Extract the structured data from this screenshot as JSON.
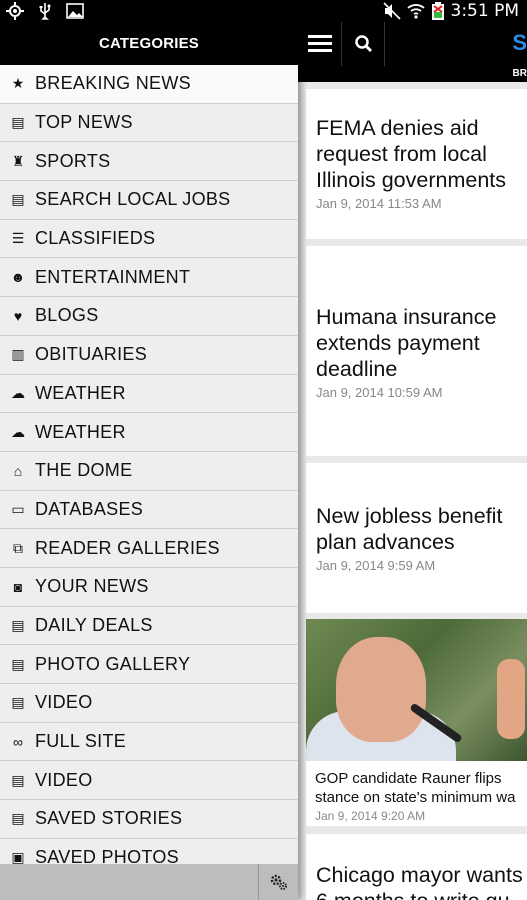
{
  "status_bar": {
    "time": "3:51 PM",
    "left_icons": [
      "gps-icon",
      "usb-icon",
      "image-icon"
    ],
    "right_icons": [
      "mute-icon",
      "wifi-icon",
      "battery-icon"
    ]
  },
  "drawer": {
    "title": "CATEGORIES",
    "items": [
      {
        "label": "BREAKING NEWS",
        "icon": "star-icon"
      },
      {
        "label": "TOP NEWS",
        "icon": "newspaper-icon"
      },
      {
        "label": "SPORTS",
        "icon": "trophy-icon"
      },
      {
        "label": "SEARCH LOCAL JOBS",
        "icon": "newspaper-icon"
      },
      {
        "label": "CLASSIFIEDS",
        "icon": "list-icon"
      },
      {
        "label": "ENTERTAINMENT",
        "icon": "masks-icon"
      },
      {
        "label": "BLOGS",
        "icon": "pin-icon"
      },
      {
        "label": "OBITUARIES",
        "icon": "tombstone-icon"
      },
      {
        "label": "WEATHER",
        "icon": "weather-icon"
      },
      {
        "label": "WEATHER",
        "icon": "weather-icon"
      },
      {
        "label": "THE DOME",
        "icon": "capitol-icon"
      },
      {
        "label": "DATABASES",
        "icon": "laptop-icon"
      },
      {
        "label": "READER GALLERIES",
        "icon": "gallery-icon"
      },
      {
        "label": "YOUR NEWS",
        "icon": "camera-icon"
      },
      {
        "label": "DAILY DEALS",
        "icon": "newspaper-icon"
      },
      {
        "label": "PHOTO GALLERY",
        "icon": "newspaper-icon"
      },
      {
        "label": "VIDEO",
        "icon": "newspaper-icon"
      },
      {
        "label": "FULL SITE",
        "icon": "link-icon"
      },
      {
        "label": "VIDEO",
        "icon": "newspaper-icon"
      },
      {
        "label": "SAVED STORIES",
        "icon": "saved-icon"
      },
      {
        "label": "SAVED PHOTOS",
        "icon": "saved-photo-icon"
      }
    ]
  },
  "news": {
    "logo": "S",
    "sub_label": "BR",
    "stories": [
      {
        "headline_lines": [
          "FEMA denies aid",
          "request from local",
          "Illinois governments"
        ],
        "date": "Jan 9, 2014 11:53 AM"
      },
      {
        "headline_lines": [
          "Humana insurance",
          "extends payment",
          "deadline"
        ],
        "date": "Jan 9, 2014 10:59 AM"
      },
      {
        "headline_lines": [
          "New jobless benefit",
          "plan advances"
        ],
        "date": "Jan 9, 2014 9:59 AM"
      },
      {
        "caption_lines": [
          "GOP candidate Rauner flips",
          "stance on state's minimum wa"
        ],
        "date": "Jan 9, 2014 9:20 AM"
      },
      {
        "headline_lines": [
          "Chicago mayor wants",
          "6 months to write gu"
        ],
        "date": ""
      }
    ]
  }
}
